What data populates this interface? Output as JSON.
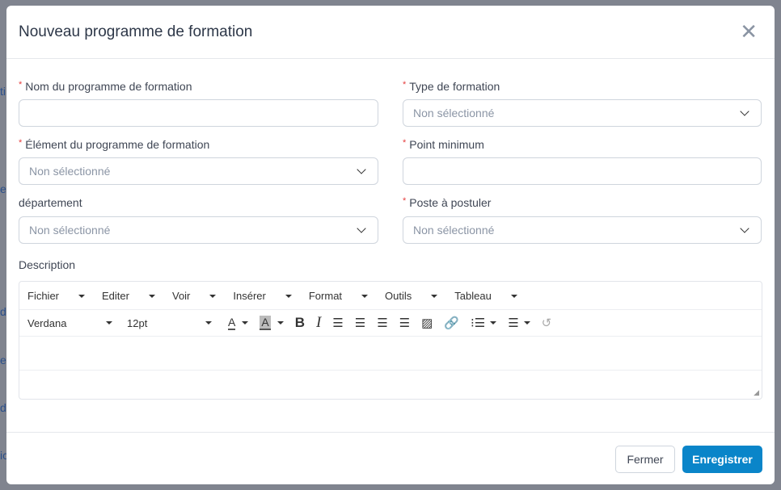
{
  "background": {
    "fragments": [
      "ti",
      "e",
      "de",
      "e",
      "de",
      "ic"
    ]
  },
  "modal": {
    "title": "Nouveau programme de formation"
  },
  "fields": {
    "nom": {
      "label": "Nom du programme de formation",
      "value": ""
    },
    "type": {
      "label": "Type de formation",
      "placeholder": "Non sélectionné"
    },
    "element": {
      "label": "Élément du programme de formation",
      "placeholder": "Non sélectionné"
    },
    "point": {
      "label": "Point minimum",
      "value": ""
    },
    "departement": {
      "label": "département",
      "placeholder": "Non sélectionné"
    },
    "poste": {
      "label": "Poste à postuler",
      "placeholder": "Non sélectionné"
    }
  },
  "description": {
    "label": "Description",
    "menu": [
      "Fichier",
      "Editer",
      "Voir",
      "Insérer",
      "Format",
      "Outils",
      "Tableau"
    ],
    "font": "Verdana",
    "size": "12pt",
    "bold": "B",
    "italic": "I",
    "text_color_glyph": "A",
    "bg_color_glyph": "A"
  },
  "footer": {
    "close_label": "Fermer",
    "save_label": "Enregistrer"
  },
  "colors": {
    "primary": "#0a85c9",
    "required": "#e53e3e"
  }
}
